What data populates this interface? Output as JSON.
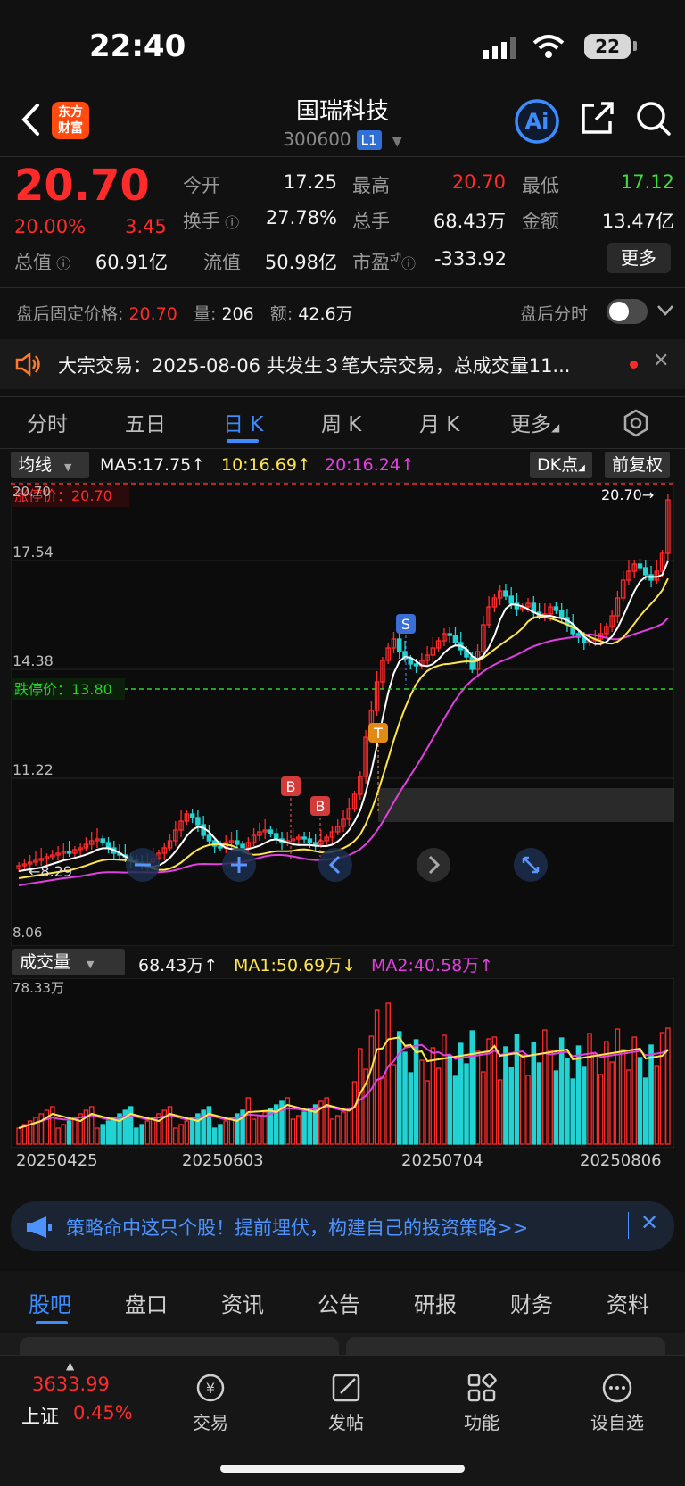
{
  "status": {
    "time": "22:40",
    "battery": "22"
  },
  "header": {
    "logo": "东方\n财富",
    "name": "国瑞科技",
    "code": "300600",
    "level": "L1"
  },
  "quote": {
    "price": "20.70",
    "change_pct": "20.00%",
    "change": "3.45",
    "open_label": "今开",
    "open": "17.25",
    "high_label": "最高",
    "high": "20.70",
    "low_label": "最低",
    "low": "17.12",
    "turnover_label": "换手",
    "turnover": "27.78%",
    "volume_label": "总手",
    "volume": "68.43万",
    "amount_label": "金额",
    "amount": "13.47亿",
    "mktcap_label": "总值",
    "mktcap": "60.91亿",
    "float_label": "流值",
    "float": "50.98亿",
    "pe_label": "市盈",
    "pe_sup": "动",
    "pe": "-333.92",
    "more": "更多"
  },
  "after_hours": {
    "price_label": "盘后固定价格:",
    "price": "20.70",
    "qty_label": "量:",
    "qty": "206",
    "amount_label": "额:",
    "amount": "42.6万",
    "toggle_label": "盘后分时"
  },
  "block_trade": {
    "text": "大宗交易：2025-08-06 共发生３笔大宗交易，总成交量11..."
  },
  "chart_tabs": [
    "分时",
    "五日",
    "日 K",
    "周 K",
    "月 K",
    "更多"
  ],
  "ma_row": {
    "selector": "均线",
    "ma5": "MA5:17.75",
    "ma10": "10:16.69",
    "ma20": "20:16.24",
    "dk": "DK点",
    "adjust": "前复权"
  },
  "price_chart": {
    "limit_up": "涨停价：20.70",
    "limit_down": "跌停价：13.80",
    "last_label": "20.70",
    "axis_top": "20.70",
    "axis_labels": [
      "17.54",
      "14.38",
      "11.22"
    ],
    "min_label": "8.29",
    "bottom_label": "8.06",
    "markers": {
      "s": "S",
      "t": "T",
      "b1": "B",
      "b2": "B"
    }
  },
  "vol_header": {
    "selector": "成交量",
    "vol": "68.43万",
    "ma1": "MA1:50.69万",
    "ma2": "MA2:40.58万",
    "axis_top": "78.33万"
  },
  "dates": [
    "20250425",
    "20250603",
    "20250704",
    "20250806"
  ],
  "banner": {
    "text": "策略命中这只个股！提前埋伏，构建自己的投资策略>>"
  },
  "section_tabs": [
    "股吧",
    "盘口",
    "资讯",
    "公告",
    "研报",
    "财务",
    "资料"
  ],
  "bottom_nav": {
    "index_value": "3633.99",
    "index_name": "上证",
    "index_change": "0.45%",
    "items": [
      "交易",
      "发帖",
      "功能",
      "设自选"
    ]
  },
  "colors": {
    "up": "#ff2b2b",
    "down": "#22d3d3",
    "ma5": "#ffffff",
    "ma10": "#ffe44d",
    "ma20": "#e040e0",
    "accent": "#3c8cff"
  }
}
